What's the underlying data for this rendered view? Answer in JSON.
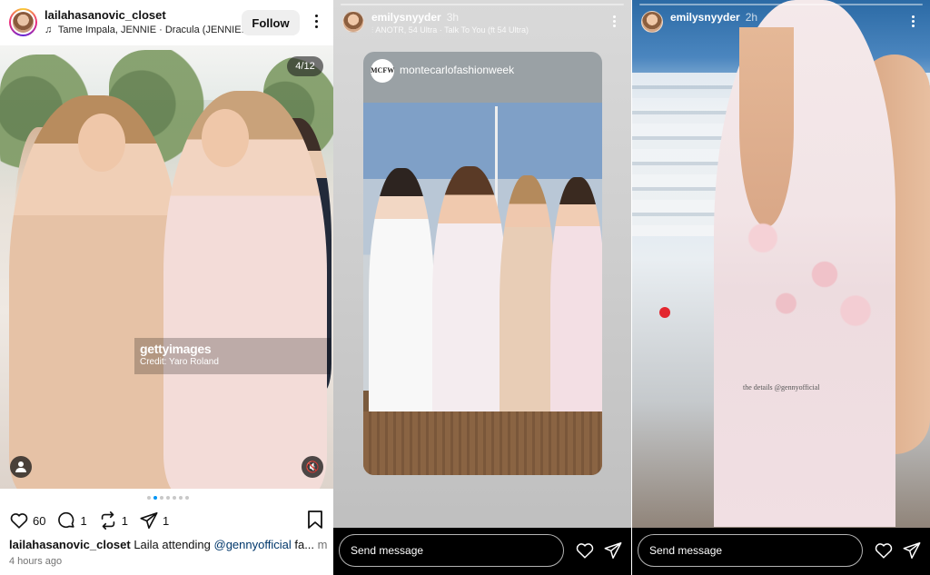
{
  "post": {
    "username": "lailahasanovic_closet",
    "audio": "Tame Impala, JENNIE · Dracula (JENNIE...",
    "follow_label": "Follow",
    "counter": "4/12",
    "watermark_brand": "gettyimages",
    "watermark_credit": "Credit: Yaro Roland",
    "carousel_dots": 7,
    "carousel_active": 1,
    "likes": "60",
    "comments": "1",
    "reposts": "1",
    "shares": "1",
    "caption_user": "lailahasanovic_closet",
    "caption_text": "Laila attending ",
    "caption_mention": "@gennyofficial",
    "caption_trail": " fa... ",
    "caption_more": "more",
    "time_ago": "4 hours ago",
    "accent_color": "#0095f6"
  },
  "story_center": {
    "username": "emilysnyyder",
    "time": "3h",
    "song": "ANOTR, 54 Ultra · Talk To You (ft 54 Ultra)",
    "repost_logo": "MCFW",
    "repost_handle": "montecarlofashionweek",
    "message_placeholder": "Send message"
  },
  "story_right": {
    "username": "emilysnyyder",
    "time": "2h",
    "overlay_text": "the details @gennyofficial",
    "message_placeholder": "Send message"
  }
}
